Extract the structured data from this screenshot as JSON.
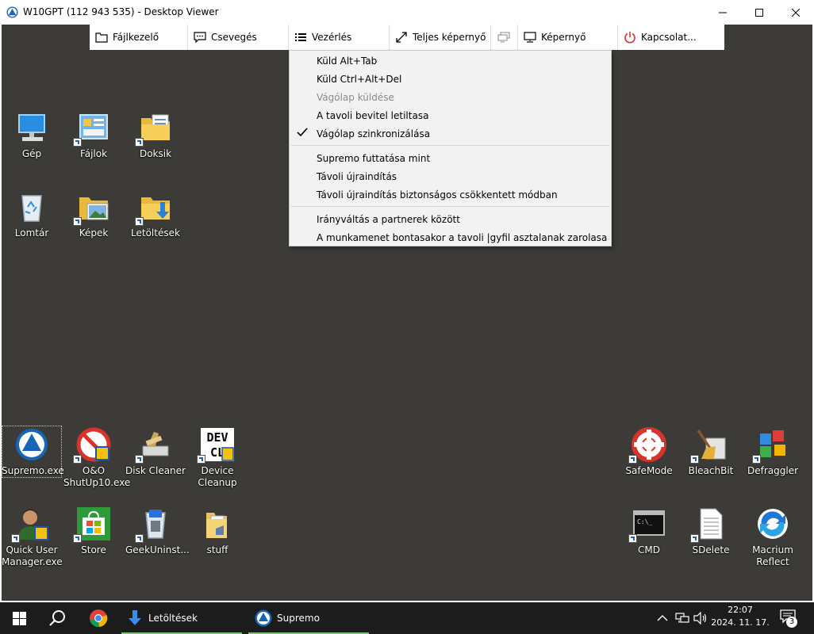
{
  "window": {
    "title": "W10GPT (112 943 535) - Desktop Viewer",
    "minimize_icon": "minimize-icon",
    "maximize_icon": "maximize-icon",
    "close_icon": "close-icon"
  },
  "toolbar": {
    "items": [
      {
        "label": "Fájlkezelő",
        "icon": "folder-icon"
      },
      {
        "label": "Csevegés",
        "icon": "chat-icon"
      },
      {
        "label": "Vezérlés",
        "icon": "list-icon"
      },
      {
        "label": "Teljes képernyő",
        "icon": "fullscreen-icon"
      },
      {
        "label": "",
        "icon": "monitors-icon"
      },
      {
        "label": "Képernyő",
        "icon": "monitor-icon"
      },
      {
        "label": "Kapcsolat...",
        "icon": "power-icon"
      }
    ]
  },
  "menu": {
    "items": [
      {
        "label": "Küld Alt+Tab",
        "enabled": true,
        "checked": false
      },
      {
        "label": "Küld Ctrl+Alt+Del",
        "enabled": true,
        "checked": false
      },
      {
        "label": "Vágólap küldése",
        "enabled": false,
        "checked": false
      },
      {
        "label": "A tavoli bevitel letiltasa",
        "enabled": true,
        "checked": false
      },
      {
        "label": "Vágólap szinkronizálása",
        "enabled": true,
        "checked": true
      },
      {
        "label": "Supremo futtatása mint",
        "enabled": true,
        "checked": false
      },
      {
        "label": "Távoli újraindítás",
        "enabled": true,
        "checked": false
      },
      {
        "label": "Távoli újraindítás biztonságos csökkentett módban",
        "enabled": true,
        "checked": false
      },
      {
        "label": "Irányváltás a partnerek között",
        "enabled": true,
        "checked": false
      },
      {
        "label": "A munkamenet bontasakor a tavoli |gyfil asztalanak zarolasa",
        "enabled": true,
        "checked": false
      }
    ]
  },
  "desktop": {
    "icons": [
      {
        "label": "Gép",
        "icon": "computer-icon"
      },
      {
        "label": "Fájlok",
        "icon": "files-icon"
      },
      {
        "label": "Doksik",
        "icon": "documents-folder-icon"
      },
      {
        "label": "Lomtár",
        "icon": "recycle-bin-icon"
      },
      {
        "label": "Képek",
        "icon": "pictures-folder-icon"
      },
      {
        "label": "Letöltések",
        "icon": "downloads-folder-icon"
      },
      {
        "label": "Supremo.exe",
        "icon": "supremo-icon"
      },
      {
        "label": "O&O ShutUp10.exe",
        "icon": "shutup10-icon"
      },
      {
        "label": "Disk Cleaner",
        "icon": "disk-cleaner-icon"
      },
      {
        "label": "Device Cleanup",
        "icon": "device-cleanup-icon"
      },
      {
        "label": "Quick User Manager.exe",
        "icon": "user-manager-icon"
      },
      {
        "label": "Store",
        "icon": "store-icon"
      },
      {
        "label": "GeekUninst...",
        "icon": "geek-uninstaller-icon"
      },
      {
        "label": "stuff",
        "icon": "folder-icon"
      },
      {
        "label": "SafeMode",
        "icon": "safemode-icon"
      },
      {
        "label": "BleachBit",
        "icon": "bleachbit-icon"
      },
      {
        "label": "Defraggler",
        "icon": "defraggler-icon"
      },
      {
        "label": "CMD",
        "icon": "cmd-icon"
      },
      {
        "label": "SDelete",
        "icon": "text-file-icon"
      },
      {
        "label": "Macrium Reflect",
        "icon": "macrium-reflect-icon"
      }
    ]
  },
  "taskbar": {
    "tasks": [
      {
        "label": "Letöltések",
        "icon": "download-arrow-icon"
      },
      {
        "label": "Supremo",
        "icon": "supremo-icon"
      }
    ],
    "clock_time": "22:07",
    "clock_date": "2024. 11. 17.",
    "notification_count": "3"
  },
  "colors": {
    "desktop_bg": "#3d3b38",
    "taskbar_bg": "#1c1c1c",
    "menu_bg": "#f2f2f2",
    "accent": "#0f6fc6",
    "power_red": "#d9302c"
  }
}
